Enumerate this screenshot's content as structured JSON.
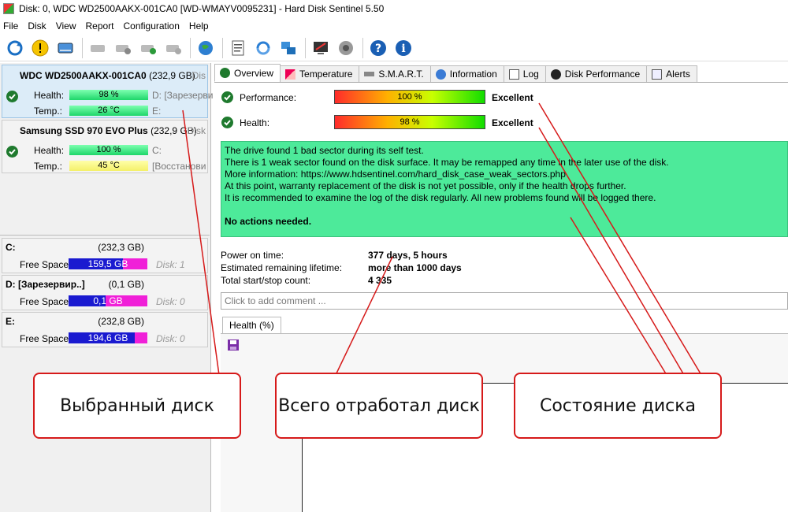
{
  "window": {
    "title": "Disk: 0, WDC WD2500AAKX-001CA0 [WD-WMAYV0095231]  -  Hard Disk Sentinel 5.50"
  },
  "menu": [
    "File",
    "Disk",
    "View",
    "Report",
    "Configuration",
    "Help"
  ],
  "toolbar": {
    "icons": [
      "refresh-icon",
      "warning-icon",
      "disk-icon",
      "tools-icon",
      "disk-test-icon",
      "disk-check-icon",
      "disk-settings-icon",
      "globe-icon",
      "report-icon",
      "update-icon",
      "network-icon",
      "terminal-icon",
      "speaker-icon",
      "help-icon",
      "info-icon"
    ]
  },
  "disks": [
    {
      "name": "WDC WD2500AAKX-001CA0",
      "size": "(232,9 GB)",
      "trail": "Dis",
      "health_label": "Health:",
      "health": "98 %",
      "temp_label": "Temp.:",
      "temp": "26 °C",
      "part1": "D: [Зарезерви",
      "part2": "E:"
    },
    {
      "name": "Samsung SSD 970 EVO Plus",
      "size": "(232,9 GB)",
      "trail": "Disk",
      "health_label": "Health:",
      "health": "100 %",
      "temp_label": "Temp.:",
      "temp": "45 °C",
      "part1": "C:",
      "part2": "[Восстанови"
    }
  ],
  "partitions": [
    {
      "name": "C:",
      "size": "(232,3 GB)",
      "free_label": "Free Space",
      "free": "159,5 GB",
      "free_fraction": 0.69,
      "disk": "Disk: 1"
    },
    {
      "name": "D: [Зарезервир..]",
      "size": "(0,1 GB)",
      "free_label": "Free Space",
      "free": "0,1 GB",
      "free_fraction": 0.47,
      "disk": "Disk: 0"
    },
    {
      "name": "E:",
      "size": "(232,8 GB)",
      "free_label": "Free Space",
      "free": "194,6 GB",
      "free_fraction": 0.84,
      "disk": "Disk: 0"
    }
  ],
  "tabs": [
    {
      "label": "Overview",
      "icon": "check-icon"
    },
    {
      "label": "Temperature",
      "icon": "thermometer-icon"
    },
    {
      "label": "S.M.A.R.T.",
      "icon": "smart-icon"
    },
    {
      "label": "Information",
      "icon": "info-icon"
    },
    {
      "label": "Log",
      "icon": "log-icon"
    },
    {
      "label": "Disk Performance",
      "icon": "performance-icon"
    },
    {
      "label": "Alerts",
      "icon": "alerts-icon"
    }
  ],
  "overview": {
    "performance_label": "Performance:",
    "performance": "100 %",
    "performance_status": "Excellent",
    "health_label": "Health:",
    "health": "98 %",
    "health_status": "Excellent",
    "message": [
      "The drive found 1 bad sector during its self test.",
      "There is 1 weak sector found on the disk surface. It may be remapped any time in the later use of the disk.",
      "More information: https://www.hdsentinel.com/hard_disk_case_weak_sectors.php",
      "At this point, warranty replacement of the disk is not yet possible, only if the health drops further.",
      "It is recommended to examine the log of the disk regularly. All new problems found will be logged there."
    ],
    "action": "No actions needed.",
    "power_on_label": "Power on time:",
    "power_on": "377 days, 5 hours",
    "lifetime_label": "Estimated remaining lifetime:",
    "lifetime": "more than 1000 days",
    "startstop_label": "Total start/stop count:",
    "startstop": "4 335",
    "comment_placeholder": "Click to add comment ...",
    "chart_tab": "Health (%)"
  },
  "callouts": [
    "Выбранный диск",
    "Всего отработал диск",
    "Состояние диска"
  ],
  "colors": {
    "callout_border": "#d61a1a",
    "info_bg": "#4dea9a",
    "status_green": "#1f7a2e"
  }
}
